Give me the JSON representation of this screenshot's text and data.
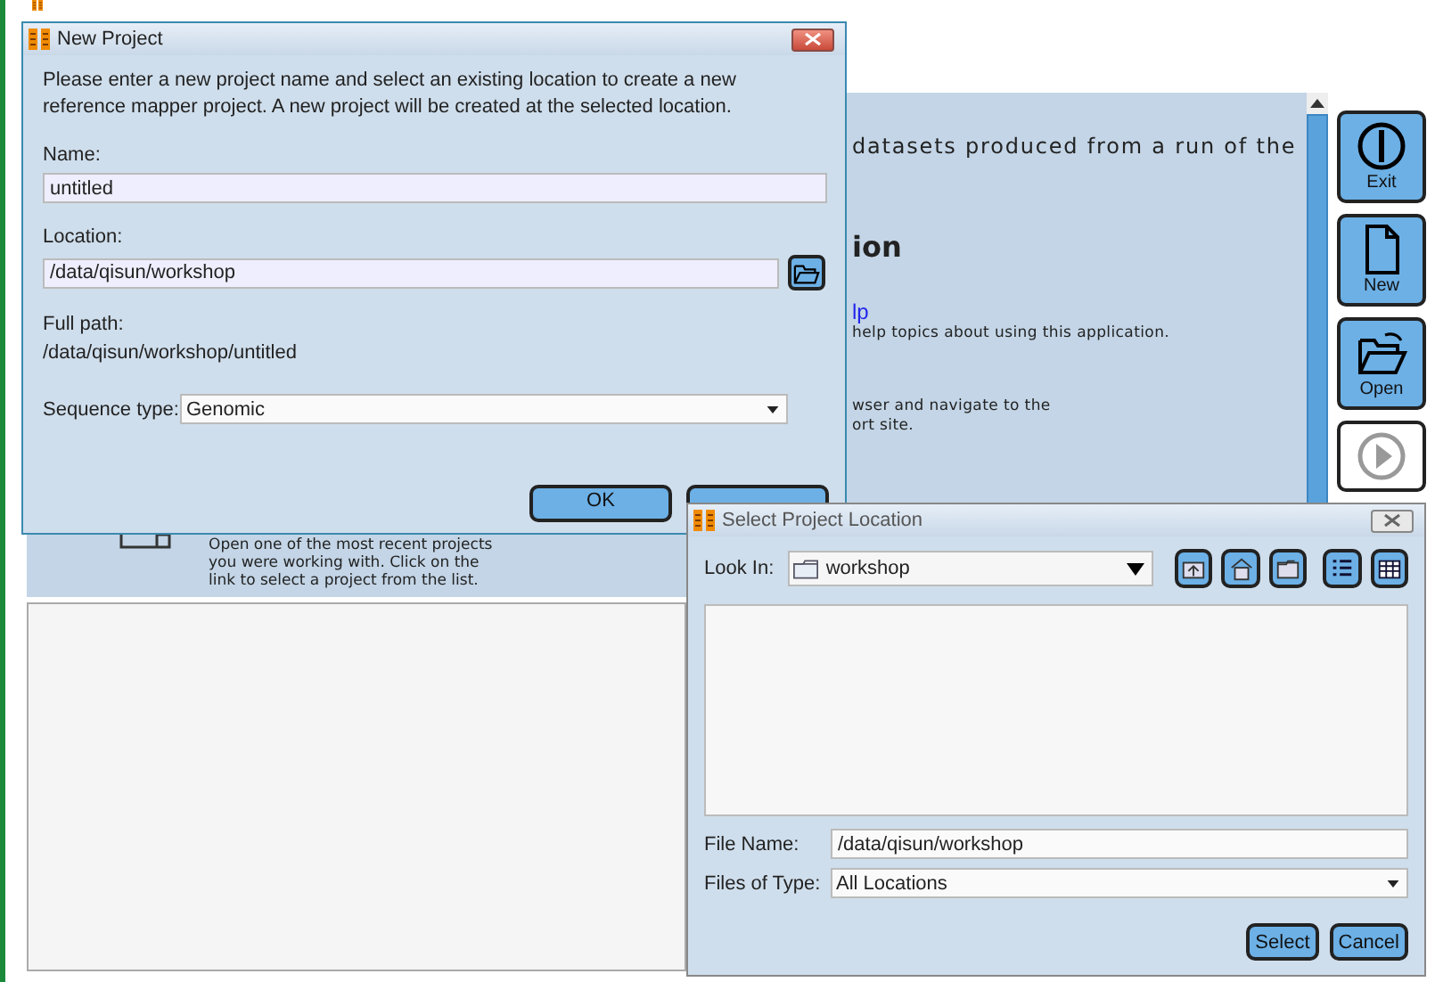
{
  "main_window": {
    "intro_text": "datasets produced from a run of the",
    "heading": "ion",
    "help_link": "lp",
    "help_text": "help topics about using this application.",
    "support_text_1": "wser and navigate to the",
    "support_text_2": "ort site.",
    "recent_text": "Open one of the most recent projects you were working with. Click on the link to select a project from the list.",
    "toolbar": [
      {
        "label": "Exit",
        "kind": "exit"
      },
      {
        "label": "New",
        "kind": "new"
      },
      {
        "label": "Open",
        "kind": "open"
      },
      {
        "kind": "run"
      }
    ]
  },
  "new_project_dialog": {
    "title": "New Project",
    "instructions": "Please enter a new project name and select an existing location to create a new reference mapper project. A new project will be created at the selected location.",
    "name_label": "Name:",
    "name_value": "untitled",
    "location_label": "Location:",
    "location_value": "/data/qisun/workshop",
    "full_path_label": "Full path:",
    "full_path_value": "/data/qisun/workshop/untitled",
    "sequence_type_label": "Sequence type:",
    "sequence_type_value": "Genomic",
    "buttons": [
      {
        "kind": "labeled",
        "label": "OK"
      },
      {
        "kind": "covered"
      }
    ]
  },
  "select_location_dialog": {
    "title": "Select Project Location",
    "look_in_label": "Look In:",
    "look_in_value": "workshop",
    "file_name_label": "File Name:",
    "file_name_value": "/data/qisun/workshop",
    "files_of_type_label": "Files of Type:",
    "files_of_type_value": "All Locations",
    "buttons": [
      {
        "label": "Select"
      },
      {
        "label": "Cancel"
      }
    ]
  }
}
